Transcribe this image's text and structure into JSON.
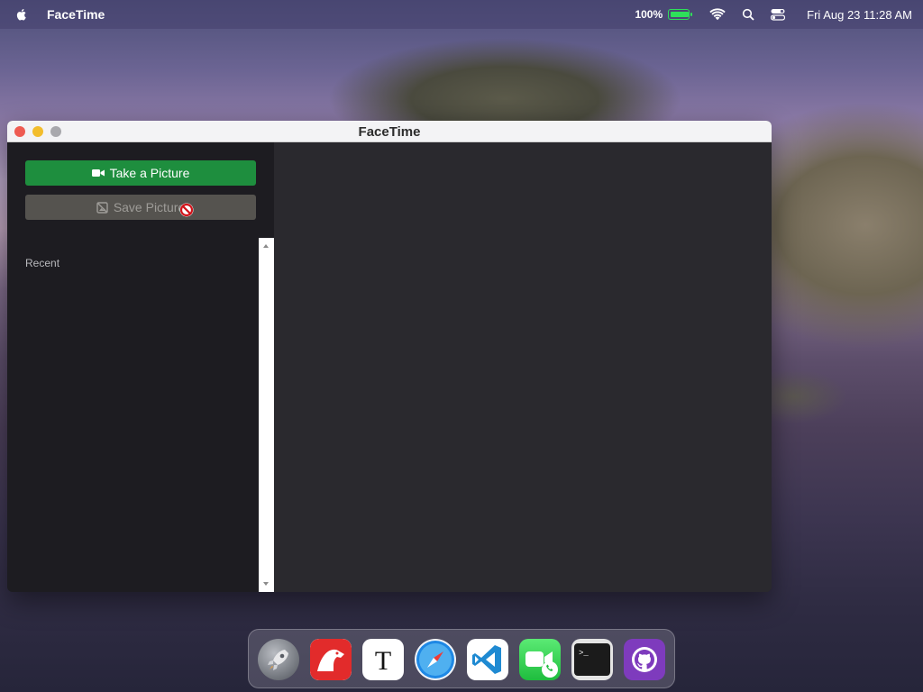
{
  "menubar": {
    "app_name": "FaceTime",
    "battery_percent_label": "100%",
    "battery_level": 1.0,
    "clock": "Fri Aug 23  11:28 AM",
    "icons": [
      "apple-icon",
      "battery-icon",
      "wifi-icon",
      "search-icon",
      "control-center-icon"
    ]
  },
  "window": {
    "title": "FaceTime",
    "buttons": {
      "take_picture": "Take a Picture",
      "save_picture": "Save Picture"
    },
    "recent_label": "Recent",
    "colors": {
      "primary_button": "#1e8e3e",
      "disabled_button": "#55534f",
      "sidebar": "#1d1c21",
      "main": "#2a292e"
    }
  },
  "dock": {
    "apps": [
      "launchpad",
      "bear",
      "typora",
      "safari",
      "visual-studio-code",
      "facetime",
      "terminal",
      "github-desktop"
    ]
  }
}
